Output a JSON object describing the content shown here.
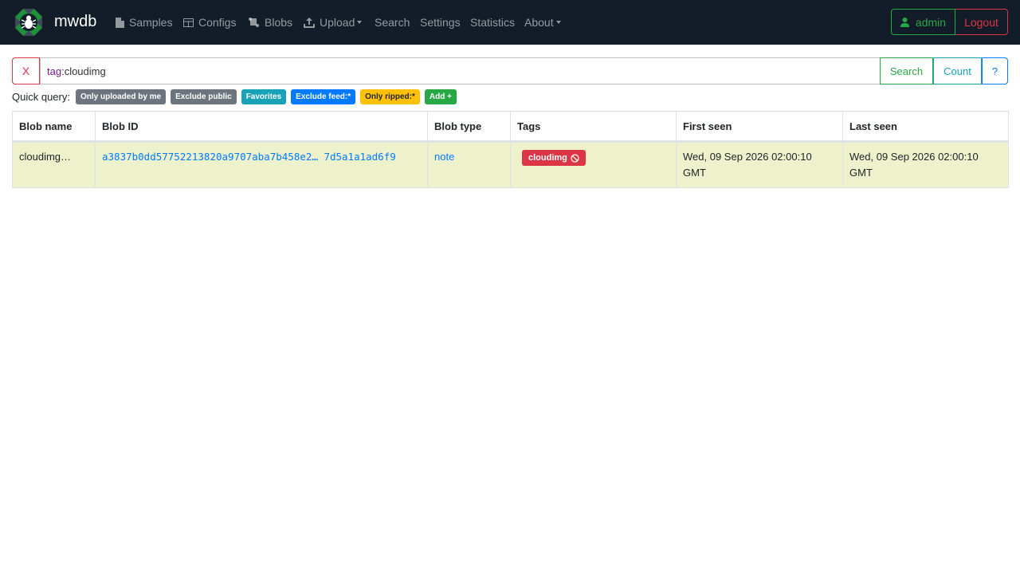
{
  "nav": {
    "brand": "mwdb",
    "items": [
      {
        "label": "Samples",
        "icon": "file-icon"
      },
      {
        "label": "Configs",
        "icon": "table-icon"
      },
      {
        "label": "Blobs",
        "icon": "scroll-icon"
      },
      {
        "label": "Upload",
        "icon": "upload-icon"
      },
      {
        "label": "Search"
      },
      {
        "label": "Settings"
      },
      {
        "label": "Statistics"
      },
      {
        "label": "About"
      }
    ],
    "user": "admin",
    "logout": "Logout"
  },
  "search": {
    "clear_label": "X",
    "query_field": "tag",
    "query_value": ":cloudimg",
    "search_label": "Search",
    "count_label": "Count",
    "help_label": "?"
  },
  "quick_query": {
    "label": "Quick query:",
    "badges": [
      {
        "label": "Only uploaded by me",
        "color": "#6c757d"
      },
      {
        "label": "Exclude public",
        "color": "#6c757d"
      },
      {
        "label": "Favorites",
        "color": "#17a2b8"
      },
      {
        "label": "Exclude feed:*",
        "color": "#007bff"
      },
      {
        "label": "Only ripped:*",
        "color": "#ffc107"
      },
      {
        "label": "Add +",
        "color": "#28a745"
      }
    ]
  },
  "table": {
    "headers": [
      "Blob name",
      "Blob ID",
      "Blob type",
      "Tags",
      "First seen",
      "Last seen"
    ],
    "rows": [
      {
        "name": "cloudimg…",
        "id": "a3837b0dd57752213820a9707aba7b458e2… 7d5a1a1ad6f9",
        "type": "note",
        "tag": "cloudimg",
        "first_seen": "Wed, 09 Sep 2026 02:00:10 GMT",
        "last_seen": "Wed, 09 Sep 2026 02:00:10 GMT"
      }
    ]
  },
  "colors": {
    "navbar": "#121d29",
    "row_highlight": "#eef2cc",
    "tag_red": "#dc3545"
  }
}
